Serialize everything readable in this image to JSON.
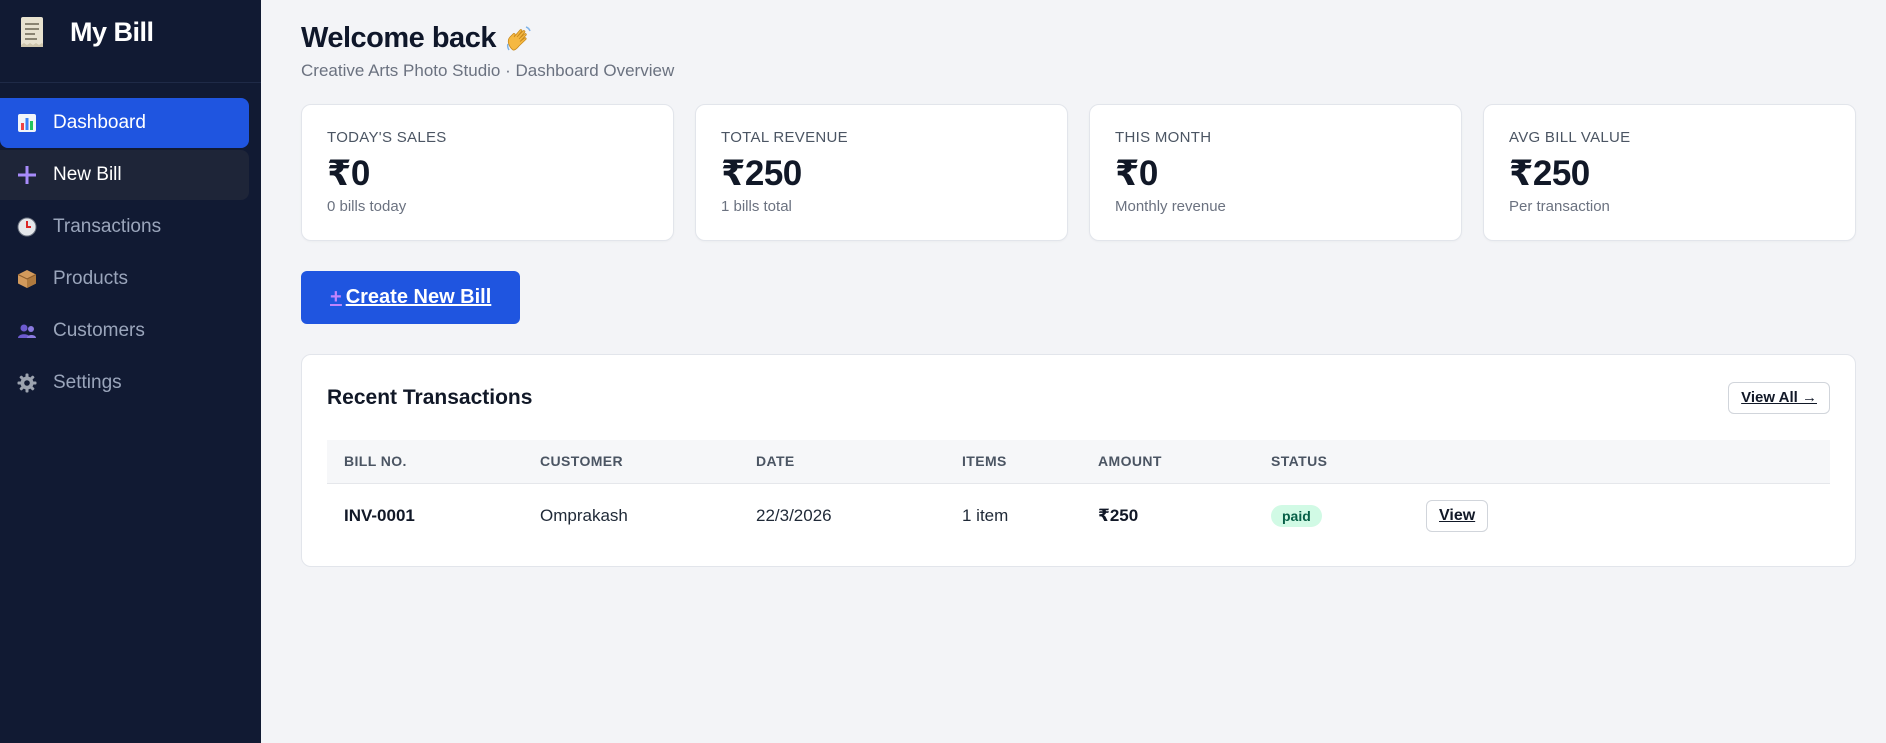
{
  "brand": {
    "title": "My Bill",
    "icon": "receipt-icon"
  },
  "nav": [
    {
      "label": "Dashboard",
      "icon": "chart-icon",
      "state": "active"
    },
    {
      "label": "New Bill",
      "icon": "plus-icon",
      "state": "hover"
    },
    {
      "label": "Transactions",
      "icon": "clock-icon",
      "state": ""
    },
    {
      "label": "Products",
      "icon": "package-icon",
      "state": ""
    },
    {
      "label": "Customers",
      "icon": "users-icon",
      "state": ""
    },
    {
      "label": "Settings",
      "icon": "gear-icon",
      "state": ""
    }
  ],
  "header": {
    "title": "Welcome back",
    "subtitle": "Creative Arts Photo Studio · Dashboard Overview"
  },
  "stats": [
    {
      "label": "TODAY'S SALES",
      "value": "₹0",
      "sub": "0 bills today"
    },
    {
      "label": "TOTAL REVENUE",
      "value": "₹250",
      "sub": "1 bills total"
    },
    {
      "label": "THIS MONTH",
      "value": "₹0",
      "sub": "Monthly revenue"
    },
    {
      "label": "AVG BILL VALUE",
      "value": "₹250",
      "sub": "Per transaction"
    }
  ],
  "create_button": {
    "icon": "+",
    "label": "Create New Bill"
  },
  "recent": {
    "title": "Recent Transactions",
    "view_all": "View All →",
    "columns": [
      "BILL NO.",
      "CUSTOMER",
      "DATE",
      "ITEMS",
      "AMOUNT",
      "STATUS"
    ],
    "rows": [
      {
        "bill_no": "INV-0001",
        "customer": "Omprakash",
        "date": "22/3/2026",
        "items": "1 item",
        "amount": "₹250",
        "status": "paid",
        "action": "View"
      }
    ]
  },
  "colors": {
    "sidebar_bg": "#111a33",
    "accent": "#1f55e0",
    "paid_badge_bg": "#d1fae5",
    "paid_badge_text": "#065f46"
  }
}
